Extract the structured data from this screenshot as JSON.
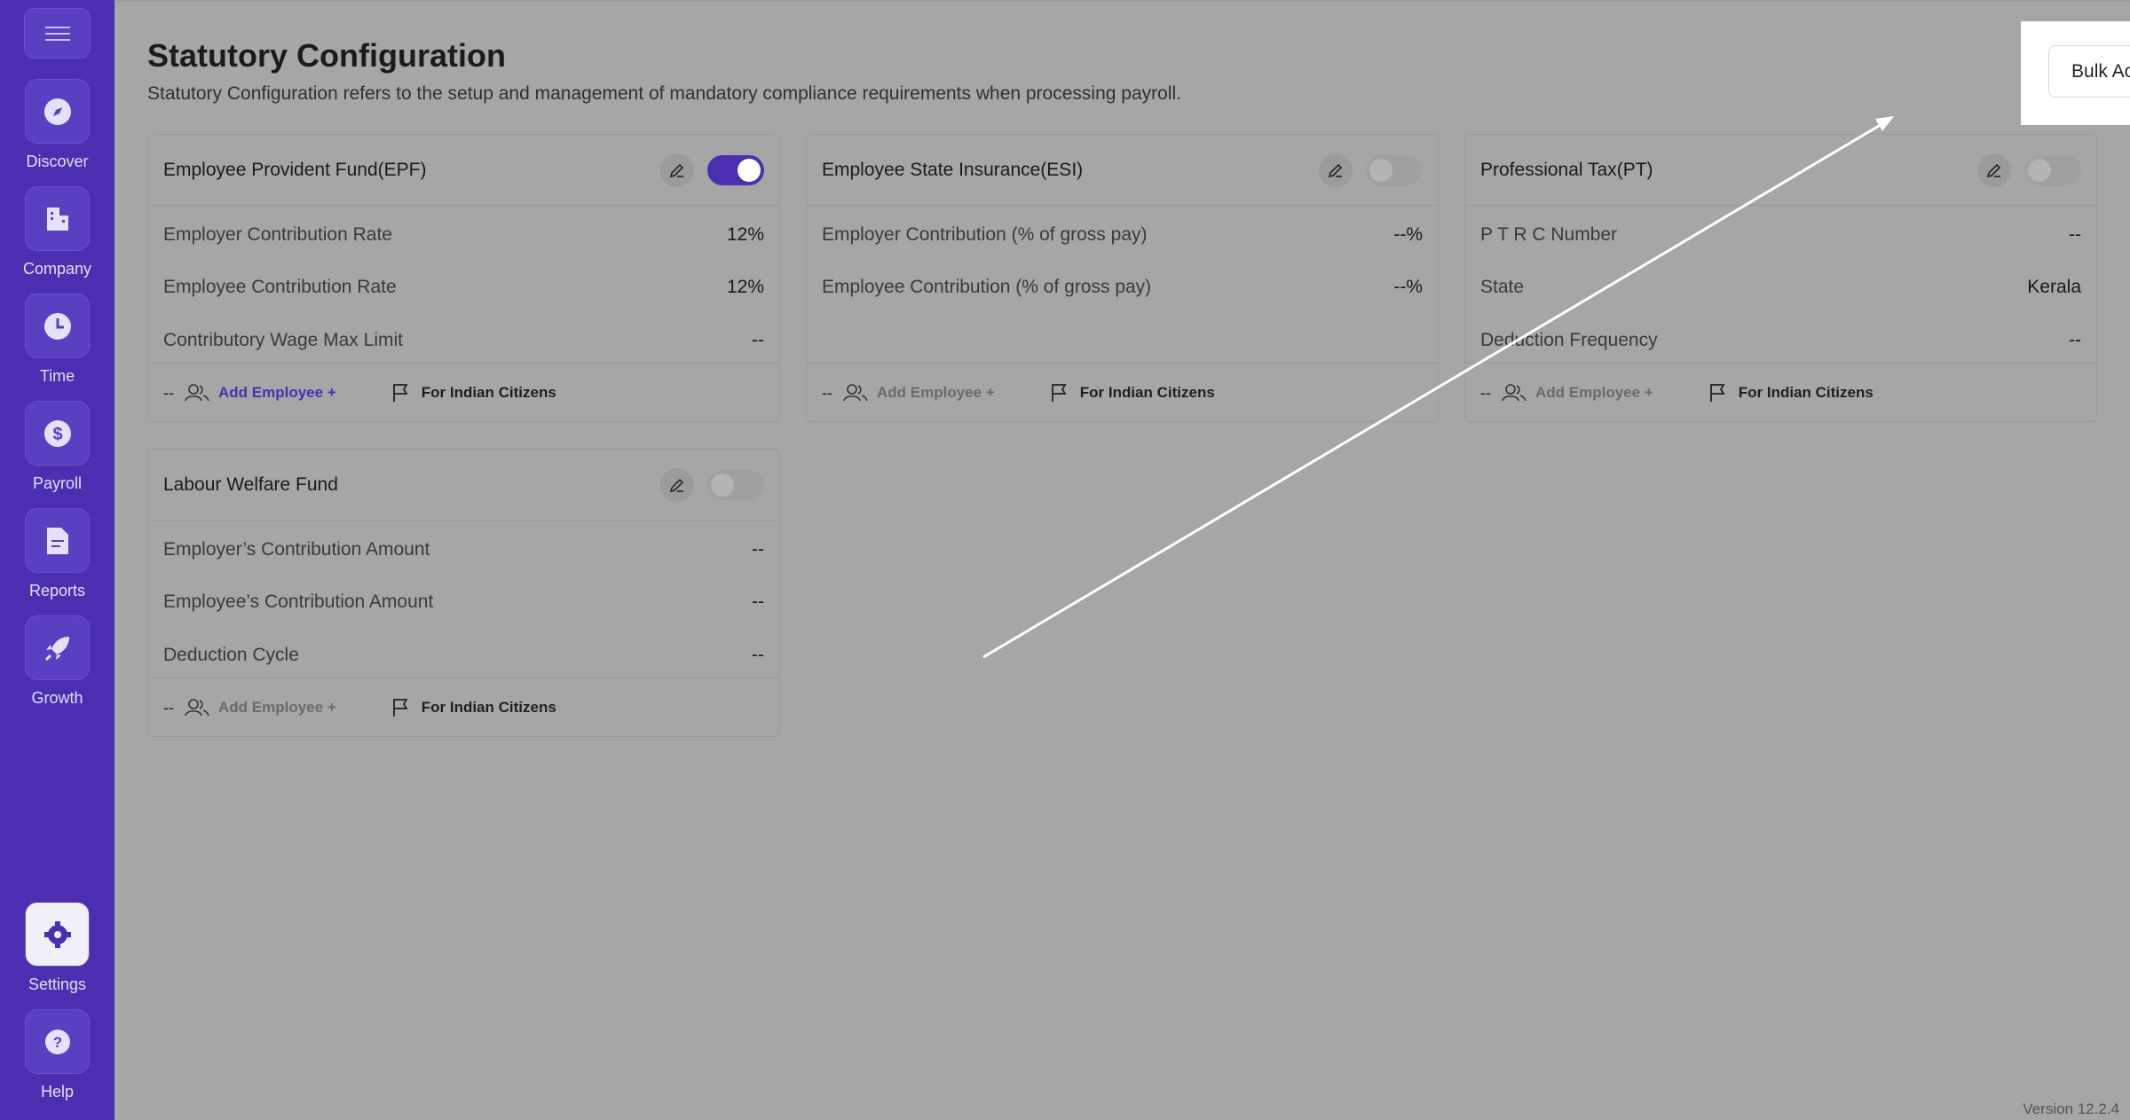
{
  "sidebar": {
    "items": [
      {
        "label": "Discover",
        "icon": "compass-icon"
      },
      {
        "label": "Company",
        "icon": "building-icon"
      },
      {
        "label": "Time",
        "icon": "clock-icon"
      },
      {
        "label": "Payroll",
        "icon": "dollar-icon"
      },
      {
        "label": "Reports",
        "icon": "document-icon"
      },
      {
        "label": "Growth",
        "icon": "rocket-icon"
      }
    ],
    "bottom": [
      {
        "label": "Settings",
        "icon": "gear-icon"
      },
      {
        "label": "Help",
        "icon": "help-icon"
      }
    ]
  },
  "header": {
    "title": "Statutory Configuration",
    "description": "Statutory Configuration refers to the setup and management of mandatory compliance requirements when processing payroll.",
    "bulk_action": "Bulk Action"
  },
  "cards": [
    {
      "title": "Employee Provident Fund(EPF)",
      "enabled": true,
      "rows": [
        {
          "label": "Employer Contribution Rate",
          "value": "12%"
        },
        {
          "label": "Employee Contribution Rate",
          "value": "12%"
        },
        {
          "label": "Contributory Wage Max Limit",
          "value": "--"
        }
      ],
      "footer": {
        "count": "--",
        "add_label": "Add Employee +",
        "flag_label": "For Indian Citizens"
      }
    },
    {
      "title": "Employee State Insurance(ESI)",
      "enabled": false,
      "rows": [
        {
          "label": "Employer Contribution (% of gross pay)",
          "value": "--%"
        },
        {
          "label": "Employee Contribution (% of gross pay)",
          "value": "--%"
        }
      ],
      "footer": {
        "count": "--",
        "add_label": "Add Employee +",
        "flag_label": "For Indian Citizens"
      }
    },
    {
      "title": "Professional Tax(PT)",
      "enabled": false,
      "rows": [
        {
          "label": "P T R C Number",
          "value": "--"
        },
        {
          "label": "State",
          "value": "Kerala"
        },
        {
          "label": "Deduction Frequency",
          "value": "--"
        }
      ],
      "footer": {
        "count": "--",
        "add_label": "Add Employee +",
        "flag_label": "For Indian Citizens"
      }
    },
    {
      "title": "Labour Welfare Fund",
      "enabled": false,
      "rows": [
        {
          "label": "Employer’s Contribution Amount",
          "value": "--"
        },
        {
          "label": "Employee’s Contribution Amount",
          "value": "--"
        },
        {
          "label": "Deduction Cycle",
          "value": "--"
        }
      ],
      "footer": {
        "count": "--",
        "add_label": "Add Employee +",
        "flag_label": "For Indian Citizens"
      }
    }
  ],
  "version": "Version 12.2.4",
  "colors": {
    "brand": "#4b2fb0",
    "overlay": "#a6a6a6"
  }
}
